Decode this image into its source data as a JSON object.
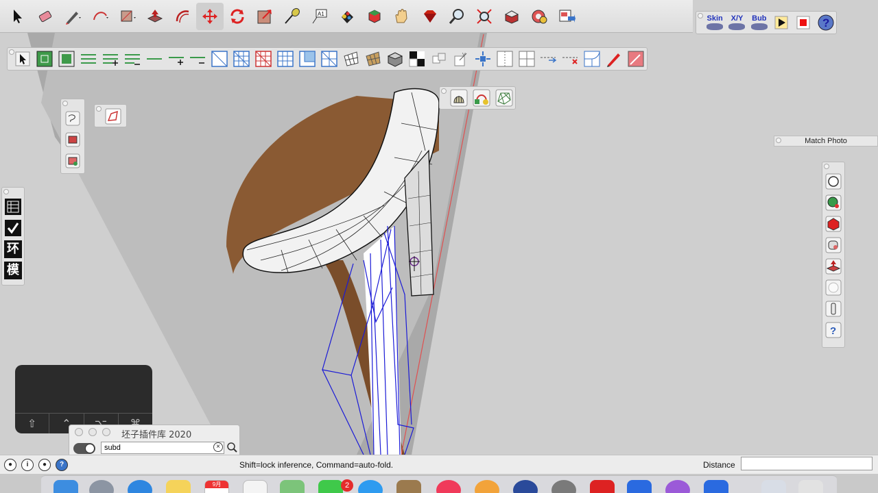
{
  "status_bar": {
    "hint": "Shift=lock inference, Command=auto-fold.",
    "distance_label": "Distance",
    "distance_value": ""
  },
  "skin_palette": {
    "buttons": [
      {
        "label": "Skin",
        "icon": "skin-icon"
      },
      {
        "label": "X/Y",
        "icon": "xy-skin-icon"
      },
      {
        "label": "Bub",
        "icon": "bubble-icon"
      },
      {
        "label": "",
        "icon": "play-icon"
      },
      {
        "label": "",
        "icon": "stop-icon"
      },
      {
        "label": "",
        "icon": "help-icon"
      }
    ]
  },
  "match_photo": {
    "title": "Match Photo"
  },
  "quick_panel": {
    "labels": [
      "环",
      "模"
    ]
  },
  "plugin_library": {
    "title": "坯子插件库 2020",
    "search_value": "subd",
    "clear_symbol": "×"
  },
  "key_overlay": {
    "keys": [
      "⇧",
      "⌃",
      "⌥",
      "⌘"
    ]
  },
  "dock": {
    "calendar_month": "9月",
    "badge": "2"
  },
  "colors": {
    "toolbar_bg": "#e4e4e4",
    "accent_blue": "#2233bb",
    "wire_blue": "#1a1ad6",
    "wood": "#8a5a33",
    "badge_red": "#e52b2b"
  }
}
